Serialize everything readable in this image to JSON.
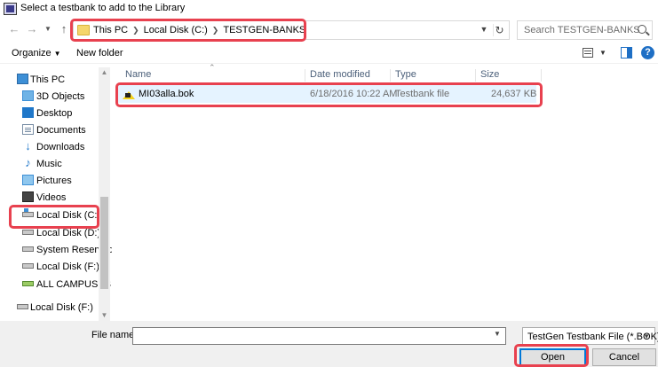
{
  "window": {
    "title": "Select a testbank to add to the Library"
  },
  "navigation": {
    "back_icon": "arrow-left",
    "forward_icon": "arrow-right",
    "recent_icon": "chevron-down",
    "up_icon": "arrow-up"
  },
  "address": {
    "crumbs": [
      "This PC",
      "Local Disk (C:)",
      "TESTGEN-BANKS"
    ]
  },
  "search": {
    "placeholder": "Search TESTGEN-BANKS"
  },
  "toolbar": {
    "organize_label": "Organize",
    "new_folder_label": "New folder"
  },
  "sidebar": {
    "items": [
      {
        "label": "This PC",
        "icon": "computer-icon"
      },
      {
        "label": "3D Objects",
        "icon": "cube-icon"
      },
      {
        "label": "Desktop",
        "icon": "desktop-icon"
      },
      {
        "label": "Documents",
        "icon": "documents-icon"
      },
      {
        "label": "Downloads",
        "icon": "download-icon"
      },
      {
        "label": "Music",
        "icon": "music-icon"
      },
      {
        "label": "Pictures",
        "icon": "pictures-icon"
      },
      {
        "label": "Videos",
        "icon": "videos-icon"
      },
      {
        "label": "Local Disk (C:)",
        "icon": "os-drive-icon"
      },
      {
        "label": "Local Disk (D:)",
        "icon": "drive-icon"
      },
      {
        "label": "System Reserved",
        "icon": "drive-icon"
      },
      {
        "label": "Local Disk (F:)",
        "icon": "drive-icon"
      },
      {
        "label": "ALL CAMPUSES",
        "icon": "network-drive-icon"
      },
      {
        "label": "Local Disk (F:)",
        "icon": "drive-icon"
      }
    ]
  },
  "file_list": {
    "columns": [
      "Name",
      "Date modified",
      "Type",
      "Size"
    ],
    "rows": [
      {
        "name": "MI03alla.bok",
        "date": "6/18/2016 10:22 AM",
        "type": "Testbank file",
        "size": "24,637 KB"
      }
    ]
  },
  "bottom": {
    "file_name_label": "File name:",
    "file_name_value": "",
    "filter_label": "TestGen Testbank File (*.BOK)",
    "open_label": "Open",
    "cancel_label": "Cancel"
  },
  "colors": {
    "highlight": "#e8414f",
    "selection": "#e5f3ff",
    "accent": "#0078d7"
  }
}
